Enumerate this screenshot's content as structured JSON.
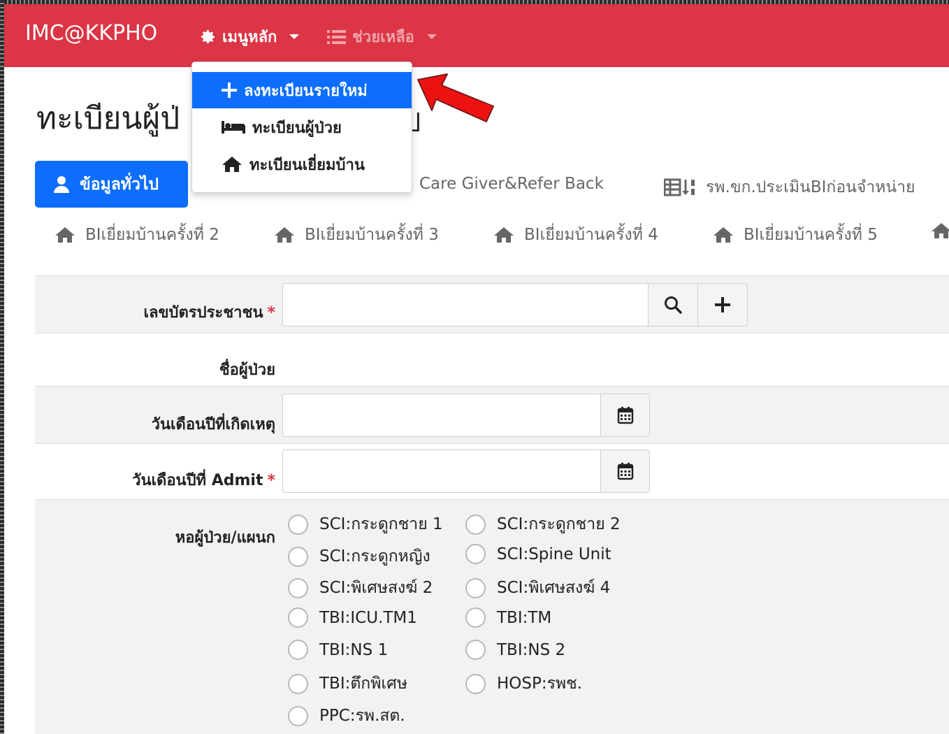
{
  "navbar": {
    "brand": "IMC@KKPHO",
    "main_menu": "เมนูหลัก",
    "help_menu": "ช่วยเหลือ",
    "color": "#dc3545"
  },
  "dropdown": {
    "items": [
      {
        "label": "ลงทะเบียนรายใหม่",
        "icon": "plus-icon",
        "active": true
      },
      {
        "label": "ทะเบียนผู้ป่วย",
        "icon": "bed-icon",
        "active": false
      },
      {
        "label": "ทะเบียนเยี่ยมบ้าน",
        "icon": "home-icon",
        "active": false
      }
    ]
  },
  "page": {
    "title_visible": "ทะเบียนผู้ป่",
    "title_right_fragment": "ป"
  },
  "tabs": {
    "active": "ข้อมูลทั่วไป",
    "row1": [
      "Care Giver&Refer Back",
      "รพ.ขก.ประเมินBIก่อนจำหน่าย"
    ],
    "row2": [
      "BIเยี่ยมบ้านครั้งที่ 2",
      "BIเยี่ยมบ้านครั้งที่ 3",
      "BIเยี่ยมบ้านครั้งที่ 4",
      "BIเยี่ยมบ้านครั้งที่ 5"
    ]
  },
  "form": {
    "citizen_id_label": "เลขบัตรประชาชน",
    "patient_name_label": "ชื่อผู้ป่วย",
    "incident_date_label": "วันเดือนปีที่เกิดเหตุ",
    "admit_date_label": "วันเดือนปีที่ Admit",
    "ward_label": "หอผู้ป่วย/แผนก",
    "required_mark": "*",
    "wards": [
      "SCI:กระดูกชาย 1",
      "SCI:กระดูกชาย 2",
      "SCI:กระดูกหญิง",
      "SCI:Spine Unit",
      "SCI:พิเศษสงฆ์ 2",
      "SCI:พิเศษสงฆ์ 4",
      "TBI:ICU.TM1",
      "TBI:TM",
      "TBI:NS 1",
      "TBI:NS 2",
      "TBI:ตึกพิเศษ",
      "HOSP:รพช.",
      "PPC:รพ.สต."
    ]
  },
  "colors": {
    "primary": "#0d6efd",
    "danger": "#dc3545",
    "annotation_arrow": "#ee1111"
  }
}
